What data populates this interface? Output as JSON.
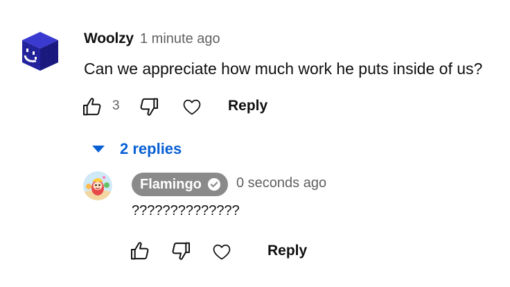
{
  "comment": {
    "author": "Woolzy",
    "timestamp": "1 minute ago",
    "text": "Can we appreciate how much work he puts inside of us?",
    "avatar_icon": "blue-cube-smiley-avatar",
    "like_icon": "thumbs-up-icon",
    "like_count": "3",
    "dislike_icon": "thumbs-down-icon",
    "heart_icon": "heart-outline-icon",
    "reply_label": "Reply"
  },
  "replies_toggle": {
    "icon": "caret-down-icon",
    "label": "2 replies"
  },
  "reply": {
    "author": "Flamingo",
    "verified_icon": "verified-check-icon",
    "timestamp": "0 seconds ago",
    "text": "??????????????",
    "avatar_icon": "cartoon-character-avatar",
    "like_icon": "thumbs-up-icon",
    "dislike_icon": "thumbs-down-icon",
    "heart_icon": "heart-outline-icon",
    "reply_label": "Reply"
  },
  "colors": {
    "link_blue": "#065fd4",
    "author_pill": "#8a8a8a",
    "secondary_text": "#606060",
    "avatar_cube": "#2a2aa8"
  }
}
